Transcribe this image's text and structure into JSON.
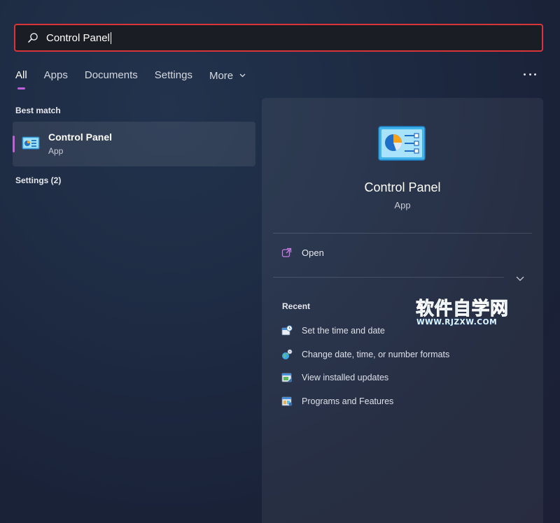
{
  "search": {
    "value": "Control Panel"
  },
  "tabs": [
    {
      "label": "All",
      "active": true
    },
    {
      "label": "Apps"
    },
    {
      "label": "Documents"
    },
    {
      "label": "Settings"
    },
    {
      "label": "More"
    }
  ],
  "left": {
    "best_match_label": "Best match",
    "best_match": {
      "title": "Control Panel",
      "subtitle": "App",
      "icon": "control-panel-icon"
    },
    "settings_label": "Settings (2)"
  },
  "detail": {
    "title": "Control Panel",
    "subtitle": "App",
    "open_label": "Open",
    "recent_label": "Recent",
    "recent_items": [
      {
        "label": "Set the time and date",
        "icon": "clock-calendar-icon"
      },
      {
        "label": "Change date, time, or number formats",
        "icon": "globe-icon"
      },
      {
        "label": "View installed updates",
        "icon": "updates-icon"
      },
      {
        "label": "Programs and Features",
        "icon": "programs-icon"
      }
    ]
  },
  "watermark": {
    "line1": "软件自学网",
    "line2": "WWW.RJZXW.COM"
  },
  "colors": {
    "accent": "#c060d8",
    "highlight_border": "#d8343a",
    "watermark_blue": "#3fa0ff"
  }
}
